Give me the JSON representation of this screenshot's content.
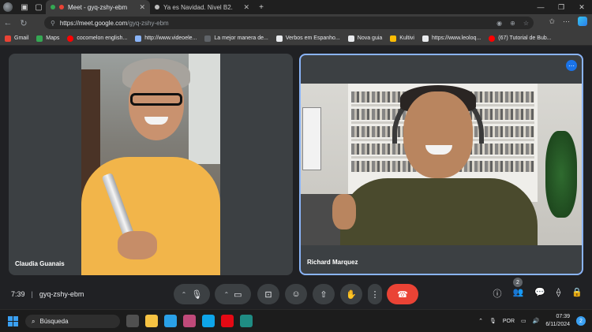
{
  "browser": {
    "tabs": [
      {
        "title": "Meet - gyq-zshy-ebm",
        "active": true
      },
      {
        "title": "Ya es Navidad. Nivel B2.",
        "active": false
      }
    ],
    "new_tab_label": "+",
    "address": {
      "host": "https://meet.google.com",
      "path": "/gyq-zshy-ebm"
    }
  },
  "bookmarks": [
    {
      "label": "Gmail",
      "icon": "gmail-icon",
      "color": "#ea4335"
    },
    {
      "label": "Maps",
      "icon": "maps-icon",
      "color": "#34a853"
    },
    {
      "label": "cocomelon english...",
      "icon": "youtube-icon",
      "color": "#ff0000"
    },
    {
      "label": "http://www.videoele...",
      "icon": "page-icon",
      "color": "#8ab4f8"
    },
    {
      "label": "La mejor manera de...",
      "icon": "page-icon",
      "color": "#5f6368"
    },
    {
      "label": "Verbos em Espanho...",
      "icon": "page-icon",
      "color": "#5f6368"
    },
    {
      "label": "Nova guia",
      "icon": "doc-icon",
      "color": "#e8eaed"
    },
    {
      "label": "Kultivi",
      "icon": "page-icon",
      "color": "#fbbc04"
    },
    {
      "label": "https://www.leoloq...",
      "icon": "doc-icon",
      "color": "#e8eaed"
    },
    {
      "label": "(67) Tutorial de Bub...",
      "icon": "youtube-icon",
      "color": "#ff0000"
    }
  ],
  "participants": [
    {
      "name": "Claudia Guanais"
    },
    {
      "name": "Richard Marquez"
    }
  ],
  "meeting": {
    "time": "7:39",
    "code": "gyq-zshy-ebm",
    "participant_count": "2"
  },
  "controls": {
    "mic_icon": "microphone-icon",
    "camera_icon": "camera-icon",
    "captions_icon": "captions-icon",
    "emoji_icon": "emoji-icon",
    "present_icon": "present-icon",
    "hand_icon": "raise-hand-icon",
    "more_icon": "more-vert-icon",
    "leave_icon": "hangup-icon",
    "leave_color": "#ea4335"
  },
  "taskbar": {
    "search_label": "Búsqueda",
    "language": "POR",
    "time": "07:39",
    "date": "6/11/2024",
    "notifications": "2"
  },
  "colors": {
    "accent": "#8ab4f8",
    "meet_bg": "#202124"
  }
}
